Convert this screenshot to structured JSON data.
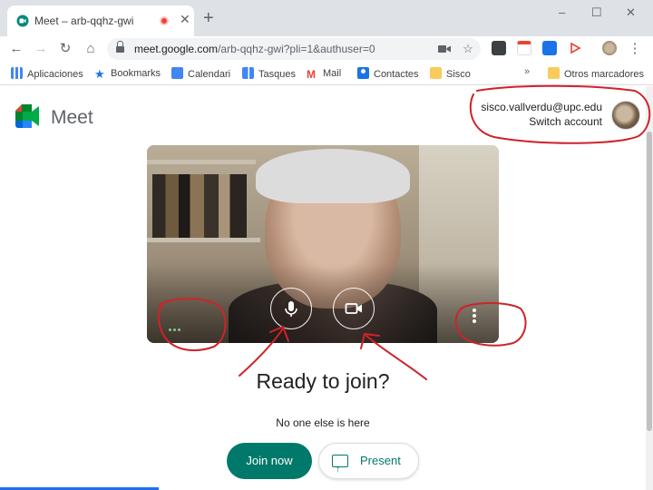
{
  "browser": {
    "tab_title": "Meet – arb-qqhz-gwi",
    "new_tab": "+",
    "window_controls": [
      "–",
      "☐",
      "✕"
    ],
    "url_host": "meet.google.com",
    "url_path": "/arb-qqhz-gwi?pli=1&authuser=0",
    "nav_icons": [
      "back-arrow-icon",
      "forward-arrow-icon",
      "reload-icon",
      "home-icon"
    ]
  },
  "bookmarks": {
    "items": [
      {
        "label": "Aplicaciones",
        "icon": "apps-grid-icon",
        "color": "#4285f4"
      },
      {
        "label": "Bookmarks",
        "icon": "star-icon",
        "color": "#1a73e8"
      },
      {
        "label": "Calendari",
        "icon": "calendar-icon",
        "color": "#4285f4"
      },
      {
        "label": "Tasques",
        "icon": "tasks-icon",
        "color": "#4285f4"
      },
      {
        "label": "Mail",
        "icon": "gmail-icon",
        "color": "#ea4335"
      },
      {
        "label": "Contactes",
        "icon": "contacts-icon",
        "color": "#1a73e8"
      },
      {
        "label": "Sisco",
        "icon": "folder-icon",
        "color": "#f9cb5b"
      }
    ],
    "overflow": "»",
    "other": {
      "label": "Otros marcadores",
      "icon": "folder-icon",
      "color": "#f9cb5b"
    }
  },
  "meet": {
    "brand": "Meet",
    "brand_colors": [
      "#00832d",
      "#0066da",
      "#e94235",
      "#2684fc",
      "#00ac47",
      "#ffba00"
    ]
  },
  "account": {
    "email": "sisco.vallverdu@upc.edu",
    "switch_label": "Switch account"
  },
  "join": {
    "heading": "Ready to join?",
    "status": "No one else is here",
    "join_label": "Join now",
    "present_label": "Present",
    "accent": "#00796b"
  },
  "annotation_color": "#d0222a"
}
